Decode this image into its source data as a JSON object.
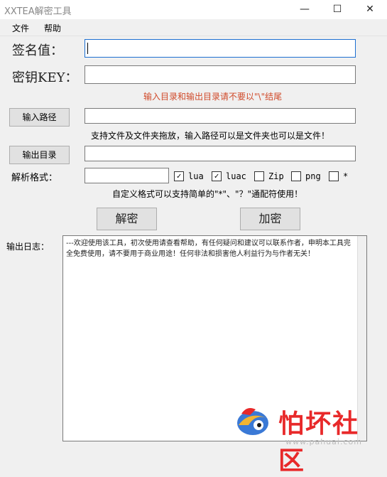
{
  "window": {
    "title": "XXTEA解密工具",
    "minimize": "—",
    "maximize": "☐",
    "close": "✕"
  },
  "menu": {
    "file": "文件",
    "help": "帮助"
  },
  "form": {
    "sign_label": "签名值：",
    "sign_value": "",
    "key_label": "密钥KEY：",
    "key_value": "",
    "warning": "输入目录和输出目录请不要以\"\\\"结尾",
    "input_path_button": "输入路径",
    "input_path_value": "",
    "input_hint": "支持文件及文件夹拖放，输入路径可以是文件夹也可以是文件！",
    "output_dir_button": "输出目录",
    "output_dir_value": "",
    "format_label": "解析格式：",
    "format_value": "",
    "formats": [
      {
        "label": "lua",
        "checked": true
      },
      {
        "label": "luac",
        "checked": true
      },
      {
        "label": "Zip",
        "checked": false
      },
      {
        "label": "png",
        "checked": false
      },
      {
        "label": "*",
        "checked": false
      }
    ],
    "format_hint": "自定义格式可以支持简单的\"*\"、\"？\"通配符使用！",
    "decrypt_button": "解密",
    "encrypt_button": "加密"
  },
  "log": {
    "label": "输出日志：",
    "text": "---欢迎使用该工具，初次使用请查看帮助，有任何疑问和建议可以联系作者，申明本工具完全免费使用，请不要用于商业用途！任何非法和损害他人利益行为与作者无关！"
  },
  "watermark": {
    "text": "怕坏社区",
    "url": "www.pahuai.com"
  },
  "colors": {
    "warning": "#d04a2a",
    "watermark": "#e8292a",
    "focus_border": "#1d6fd1"
  }
}
